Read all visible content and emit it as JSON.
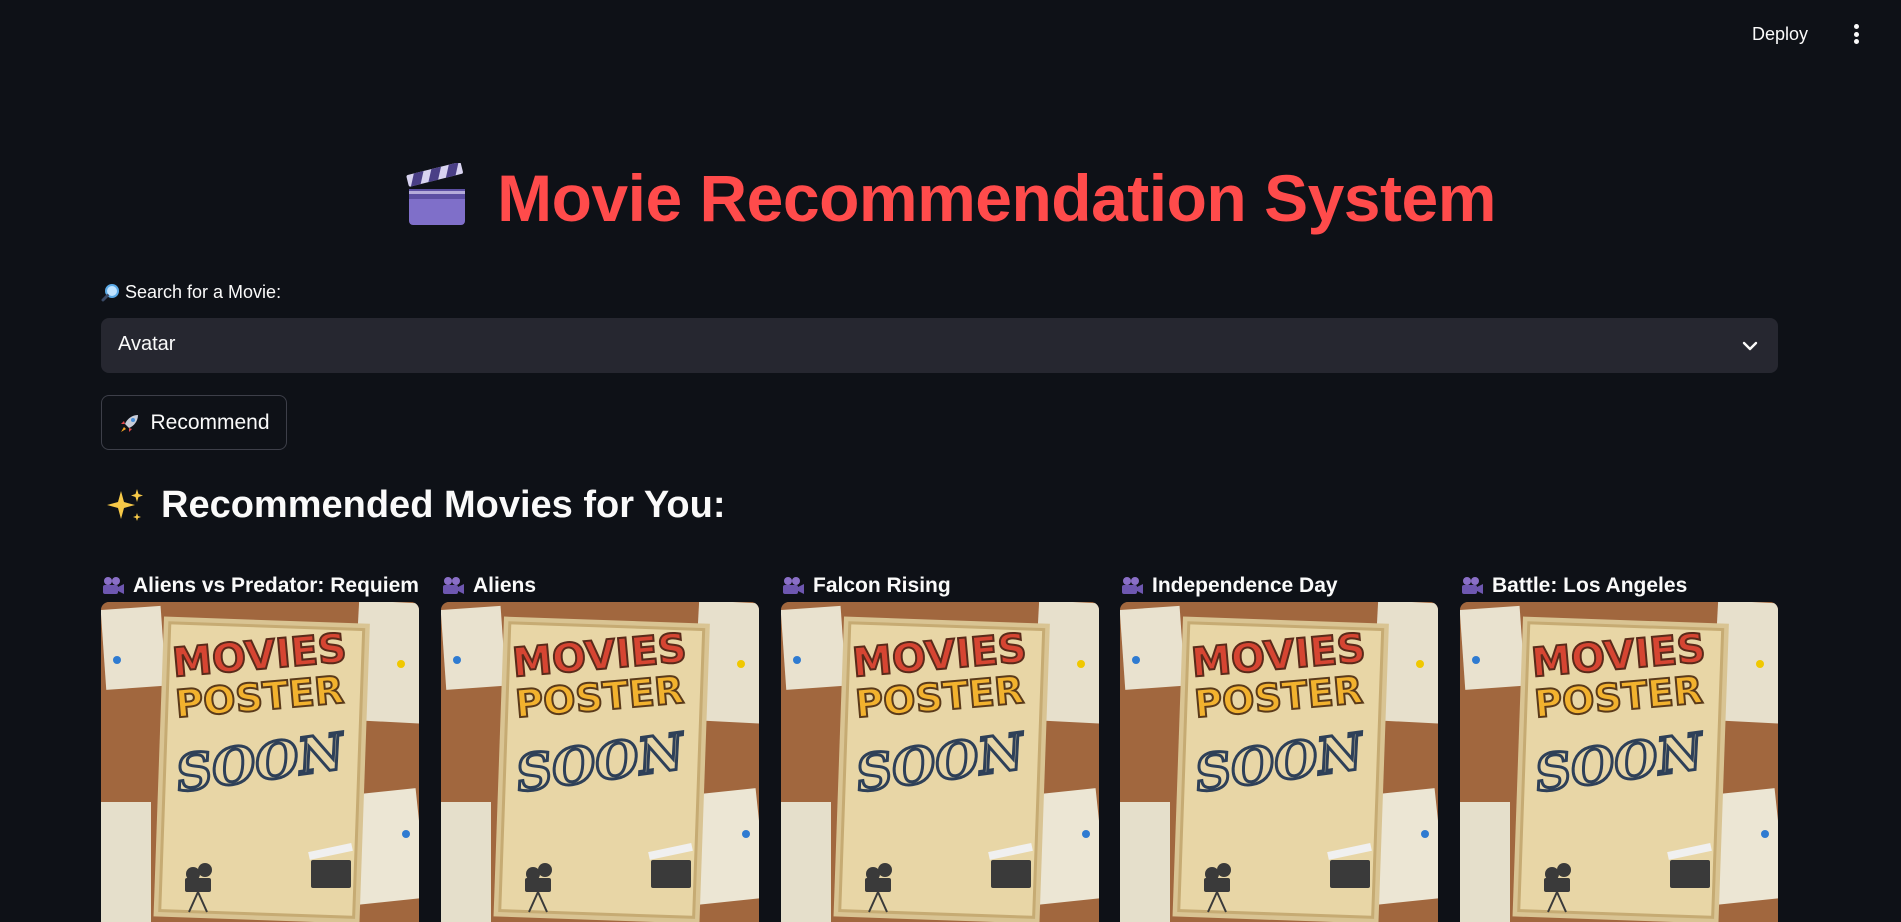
{
  "header": {
    "deploy_label": "Deploy",
    "menu_icon": "kebab-menu-icon"
  },
  "app": {
    "title": "Movie Recommendation System",
    "title_icon": "clapperboard-icon",
    "title_color": "#ff4b4b"
  },
  "search": {
    "label": "Search for a Movie:",
    "label_icon": "magnifier-icon",
    "selected": "Avatar"
  },
  "recommend_button": {
    "label": "Recommend",
    "icon": "rocket-icon"
  },
  "results": {
    "heading": "Recommended Movies for You:",
    "heading_icon": "sparkles-icon",
    "movies": [
      {
        "title": "Aliens vs Predator: Requiem"
      },
      {
        "title": "Aliens"
      },
      {
        "title": "Falcon Rising"
      },
      {
        "title": "Independence Day"
      },
      {
        "title": "Battle: Los Angeles"
      }
    ],
    "poster": {
      "line1": "MOVIES",
      "line2": "POSTER",
      "line3": "SOON"
    }
  }
}
